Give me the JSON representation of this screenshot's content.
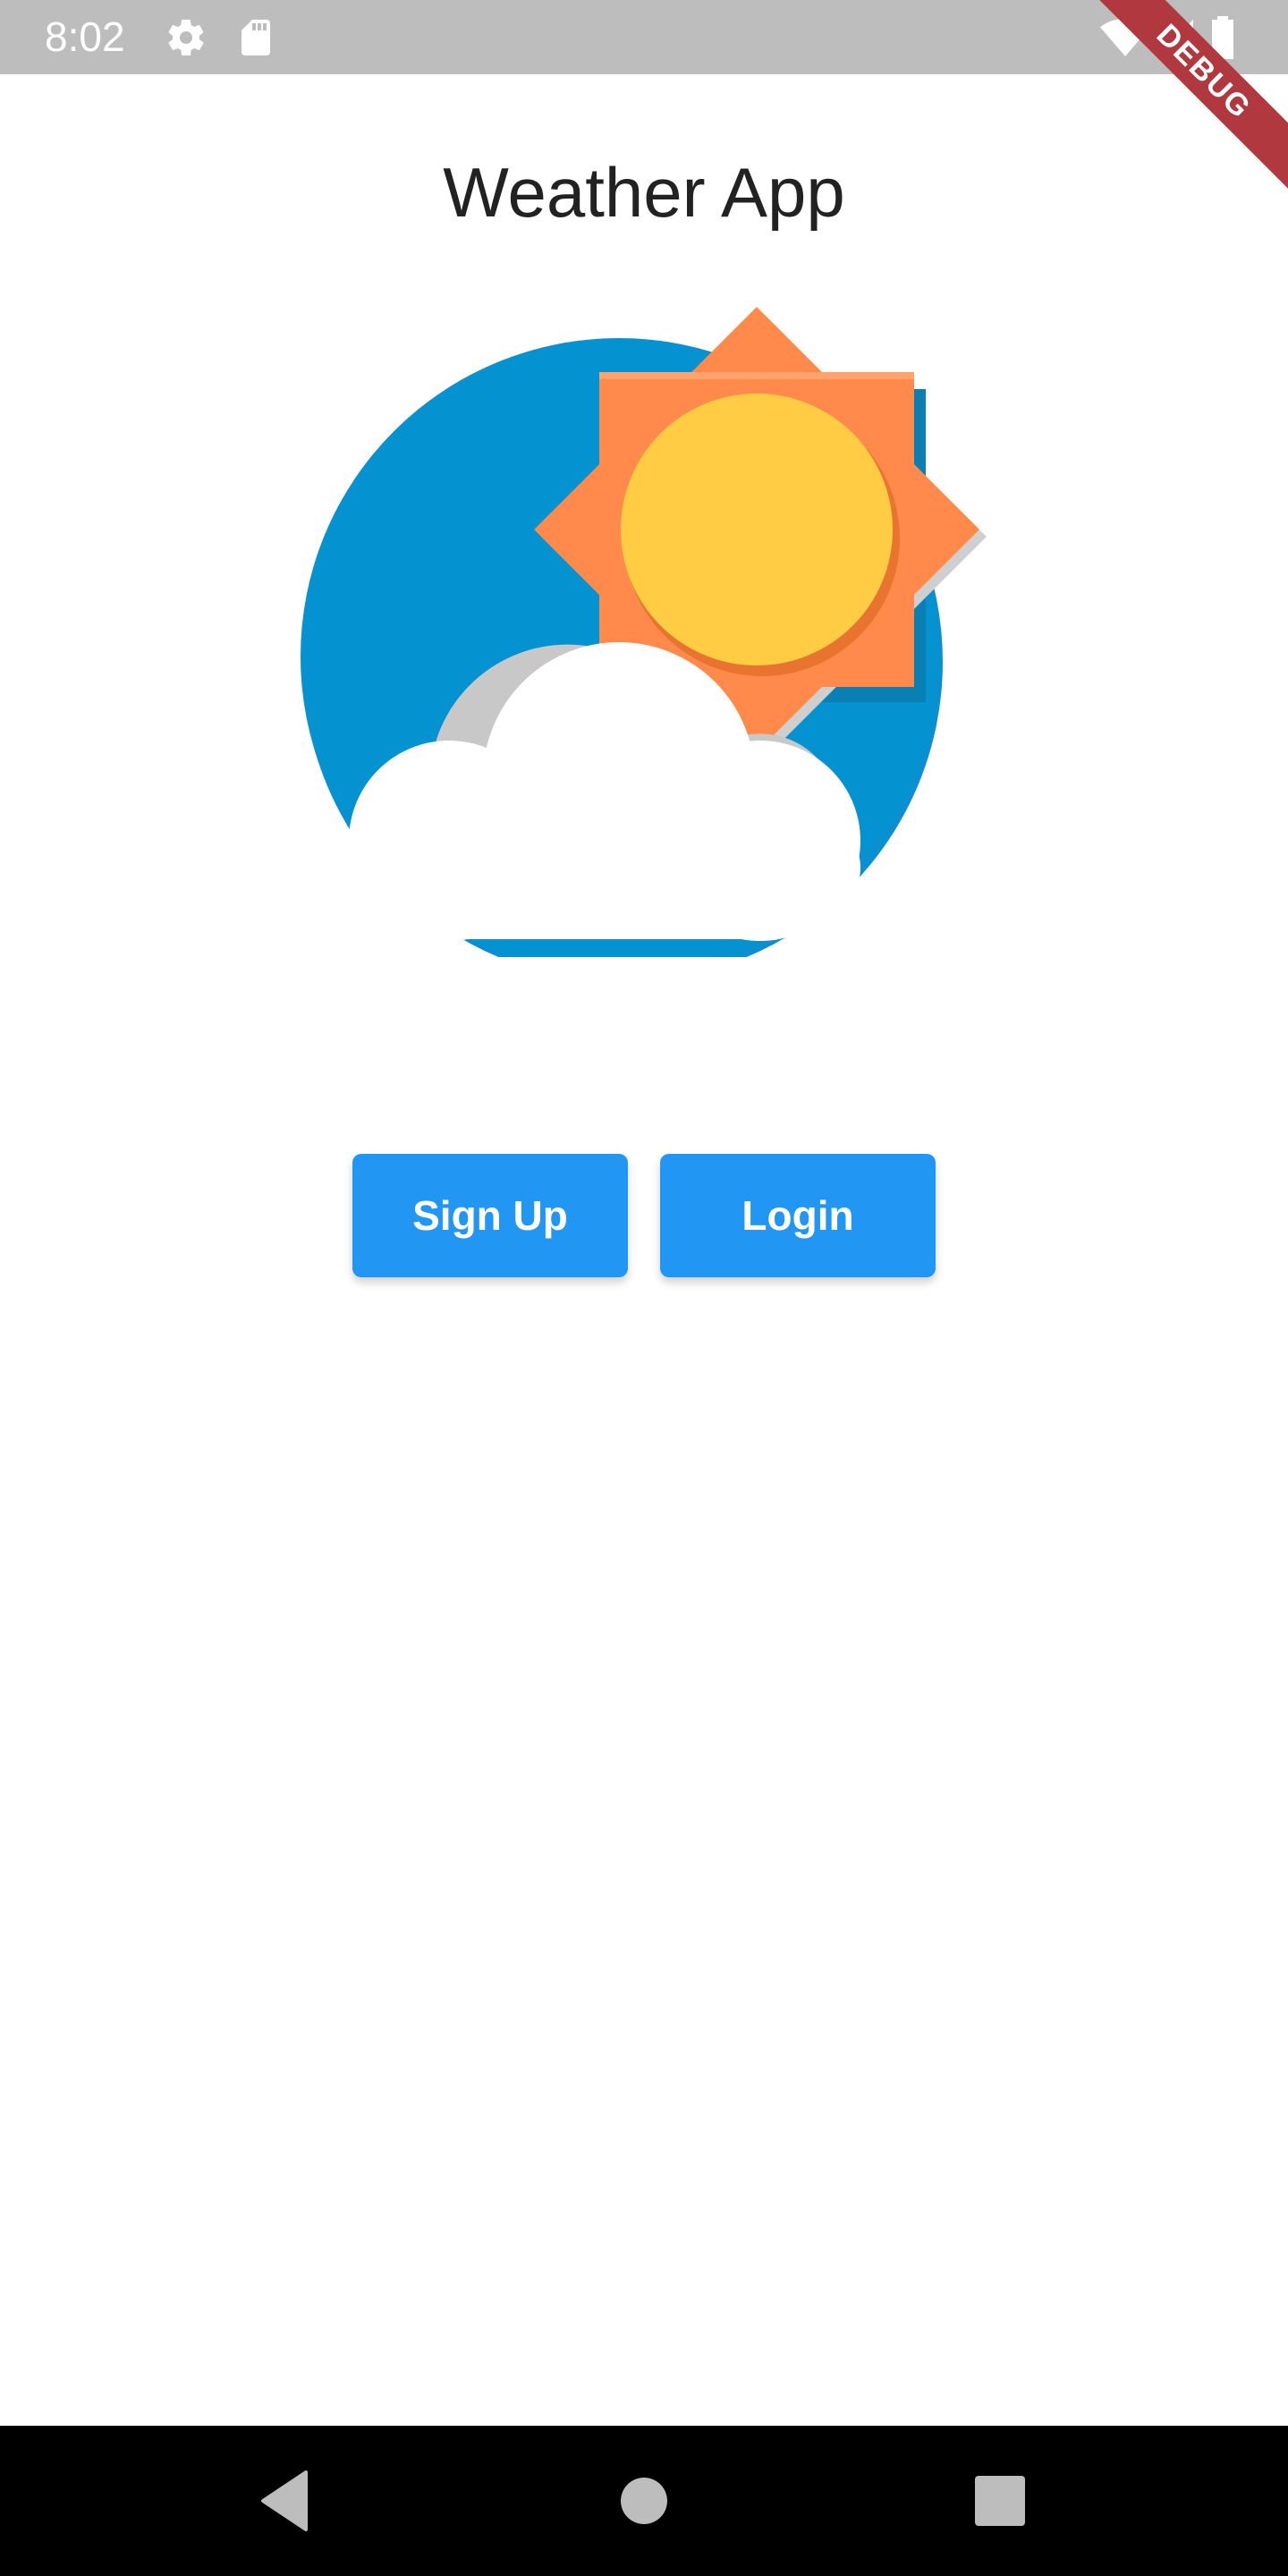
{
  "status_bar": {
    "time": "8:02",
    "icons": [
      "gear-icon",
      "sd-card-icon",
      "wifi-icon",
      "signal-icon",
      "battery-icon"
    ],
    "debug_label": "DEBUG",
    "background": "#bdbdbd"
  },
  "app": {
    "title": "Weather App",
    "logo": "sun-behind-cloud-icon"
  },
  "buttons": {
    "signup_label": "Sign Up",
    "login_label": "Login",
    "color": "#2196f3"
  },
  "nav_bar": {
    "icons": [
      "back-icon",
      "home-icon",
      "recents-icon"
    ]
  }
}
